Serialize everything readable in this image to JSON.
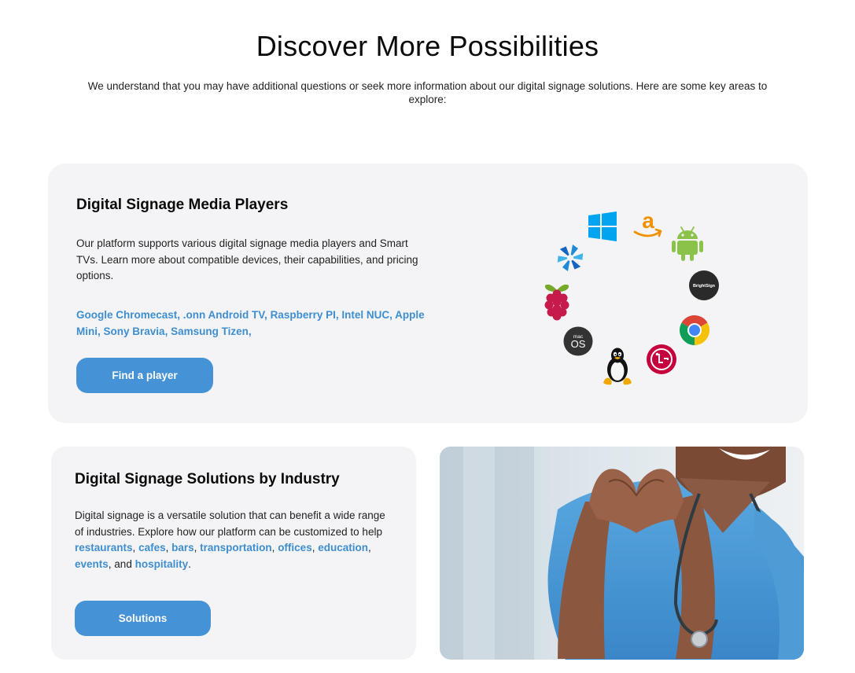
{
  "page": {
    "title": "Discover More Possibilities",
    "intro": "We understand that you may have additional questions or seek more information about our digital signage solutions. Here are some key areas to explore:"
  },
  "players_card": {
    "heading": "Digital Signage Media Players",
    "body": "Our platform supports various digital signage media players and Smart TVs. Learn more about compatible devices, their capabilities, and pricing options.",
    "device_links": [
      "Google Chromecast",
      ".onn Android TV",
      "Raspberry PI",
      "Intel NUC",
      "Apple Mini",
      "Sony Bravia",
      "Samsung Tizen"
    ],
    "button_label": "Find a player",
    "platform_icons": [
      "windows-icon",
      "amazon-icon",
      "android-icon",
      "brightsign-icon",
      "chrome-icon",
      "lg-icon",
      "linux-icon",
      "macos-icon",
      "raspberry-pi-icon",
      "tizen-icon"
    ],
    "brightsign_text": "BrightSign",
    "macos_small": "mac",
    "macos_big": "OS"
  },
  "industry_card": {
    "heading": "Digital Signage Solutions by Industry",
    "body_lead": "Digital signage is a versatile solution that can benefit a wide range of industries. Explore how our platform can be customized to help ",
    "industries": [
      "restaurants",
      "cafes",
      "bars",
      "transportation",
      "offices",
      "education",
      "events",
      "hospitality"
    ],
    "and_text": "and",
    "button_label": "Solutions"
  },
  "colors": {
    "accent": "#4593d6",
    "link": "#3e8ed0",
    "card_bg": "#f4f4f6"
  }
}
